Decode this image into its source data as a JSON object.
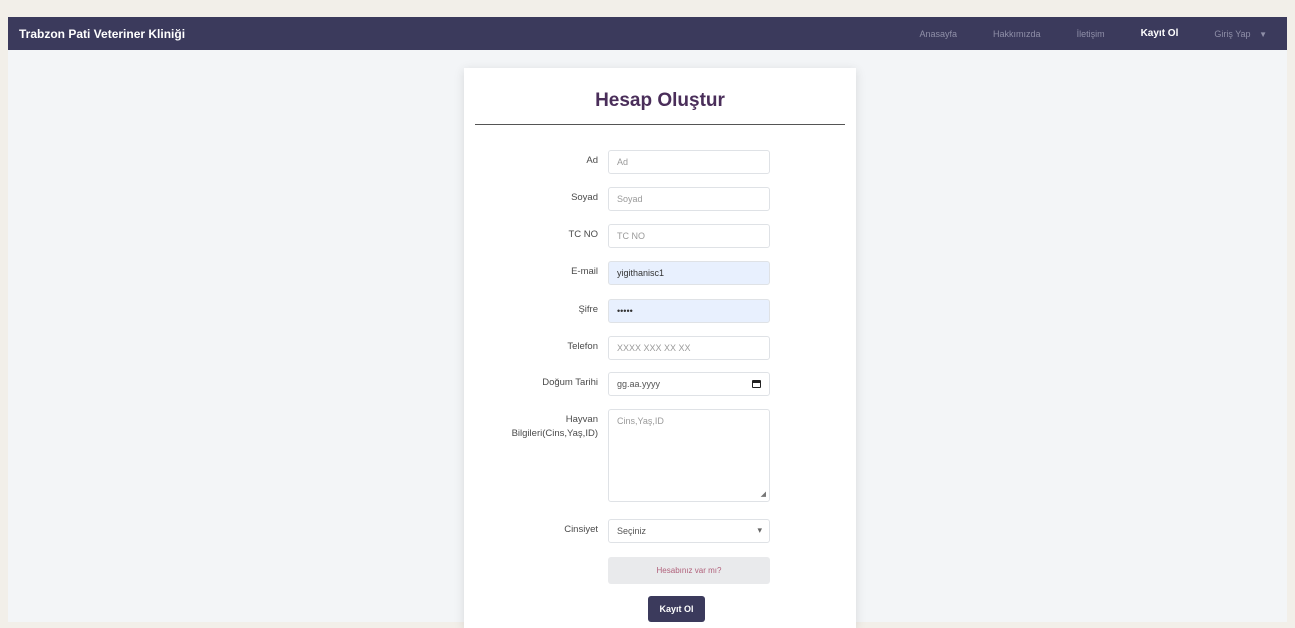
{
  "navbar": {
    "brand": "Trabzon Pati Veteriner Kliniği",
    "links": [
      {
        "label": "Anasayfa"
      },
      {
        "label": "Hakkımızda"
      },
      {
        "label": "İletişim"
      },
      {
        "label": "Kayıt Ol"
      },
      {
        "label": "Giriş Yap"
      }
    ]
  },
  "form": {
    "title": "Hesap Oluştur",
    "fields": {
      "ad": {
        "label": "Ad",
        "placeholder": "Ad",
        "value": ""
      },
      "soyad": {
        "label": "Soyad",
        "placeholder": "Soyad",
        "value": ""
      },
      "tc": {
        "label": "TC NO",
        "placeholder": "TC NO",
        "value": ""
      },
      "email": {
        "label": "E-mail",
        "placeholder": "",
        "value": "yigithanisc1"
      },
      "sifre": {
        "label": "Şifre",
        "placeholder": "",
        "value": "•••••"
      },
      "telefon": {
        "label": "Telefon",
        "placeholder": "XXXX XXX XX XX",
        "value": ""
      },
      "dogum": {
        "label": "Doğum Tarihi",
        "value": "gg.aa.yyyy"
      },
      "hayvan": {
        "label_line1": "Hayvan",
        "label_line2": "Bilgileri(Cins,Yaş,ID)",
        "placeholder": "Cins,Yaş,ID"
      },
      "cinsiyet": {
        "label": "Cinsiyet",
        "selected": "Seçiniz"
      }
    },
    "login_link": "Hesabınız var mı?",
    "submit_label": "Kayıt Ol"
  }
}
